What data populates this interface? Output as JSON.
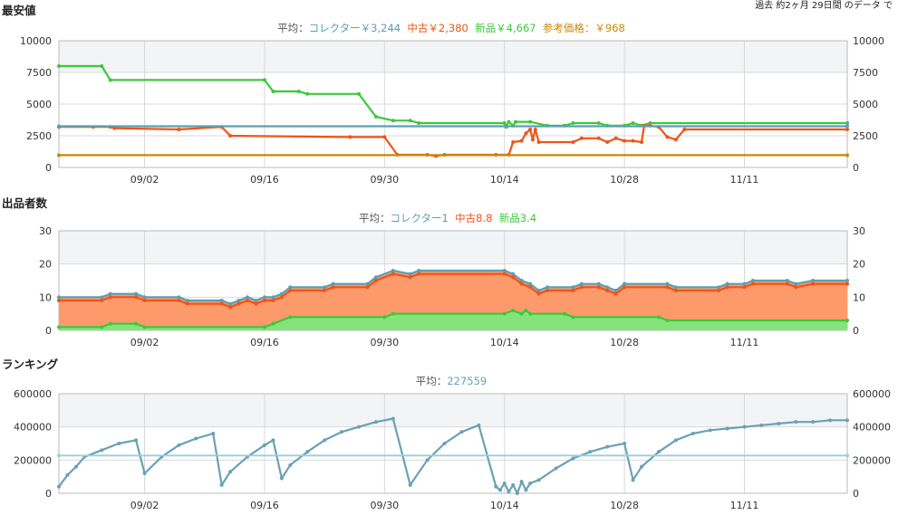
{
  "caption": "過去 約2ヶ月 29日間 のデータ で",
  "colors": {
    "collector": "#5b9fb4",
    "used": "#f25316",
    "new": "#3cc83c",
    "ref": "#c8880a",
    "used_fill": "#fd9a6c",
    "new_fill": "#86e37c",
    "rank": "#6aa1b6",
    "rank_avg": "#9ccfd8",
    "grid": "#d8d8d8",
    "band": "#f3f4f6"
  },
  "chart_data": [
    {
      "id": "price",
      "type": "line",
      "title": "最安値",
      "ylim": [
        0,
        10000
      ],
      "yticks": [
        "0",
        "2500",
        "5000",
        "7500",
        "10000"
      ],
      "xticks": [
        {
          "x": 10,
          "label": "09/02"
        },
        {
          "x": 24,
          "label": "09/16"
        },
        {
          "x": 38,
          "label": "09/30"
        },
        {
          "x": 52,
          "label": "10/14"
        },
        {
          "x": 66,
          "label": "10/28"
        },
        {
          "x": 80,
          "label": "11/11"
        }
      ],
      "xlim": [
        0,
        92
      ],
      "legend": [
        {
          "key": "collector",
          "label": "平均：コレクター￥3,244"
        },
        {
          "key": "used",
          "label": "中古￥2,380"
        },
        {
          "key": "new",
          "label": "新品￥4,667"
        },
        {
          "key": "ref",
          "label": "参考価格：￥968"
        }
      ],
      "series": [
        {
          "key": "new",
          "style": "line",
          "points": [
            [
              0,
              8000
            ],
            [
              5,
              8000
            ],
            [
              6,
              6900
            ],
            [
              24,
              6900
            ],
            [
              25,
              6000
            ],
            [
              28,
              6000
            ],
            [
              29,
              5800
            ],
            [
              35,
              5800
            ],
            [
              37,
              4000
            ],
            [
              39,
              3700
            ],
            [
              41,
              3700
            ],
            [
              42,
              3500
            ],
            [
              52,
              3500
            ],
            [
              52.2,
              3200
            ],
            [
              52.5,
              3600
            ],
            [
              53,
              3300
            ],
            [
              53.3,
              3600
            ],
            [
              55,
              3600
            ],
            [
              57,
              3300
            ],
            [
              59,
              3300
            ],
            [
              60,
              3500
            ],
            [
              63,
              3500
            ],
            [
              64,
              3300
            ],
            [
              66,
              3300
            ],
            [
              67,
              3500
            ],
            [
              68,
              3300
            ],
            [
              69,
              3500
            ],
            [
              92,
              3500
            ]
          ]
        },
        {
          "key": "used",
          "style": "line",
          "points": [
            [
              0,
              3200
            ],
            [
              4,
              3200
            ],
            [
              6,
              3200
            ],
            [
              6.5,
              3100
            ],
            [
              14,
              3000
            ],
            [
              19,
              3200
            ],
            [
              20,
              2500
            ],
            [
              34,
              2400
            ],
            [
              38,
              2400
            ],
            [
              39.5,
              1000
            ],
            [
              43,
              1000
            ],
            [
              44,
              900
            ],
            [
              45,
              1000
            ],
            [
              51,
              1000
            ],
            [
              52.5,
              1000
            ],
            [
              53,
              2000
            ],
            [
              54,
              2100
            ],
            [
              54.5,
              2700
            ],
            [
              55,
              3000
            ],
            [
              55.3,
              2200
            ],
            [
              55.6,
              3000
            ],
            [
              56,
              2000
            ],
            [
              60,
              2000
            ],
            [
              61,
              2300
            ],
            [
              63,
              2300
            ],
            [
              64,
              2000
            ],
            [
              65,
              2300
            ],
            [
              66,
              2100
            ],
            [
              67,
              2100
            ],
            [
              68,
              2000
            ],
            [
              68.3,
              3300
            ],
            [
              69,
              3300
            ],
            [
              70,
              3200
            ],
            [
              71,
              2400
            ],
            [
              72,
              2200
            ],
            [
              73,
              3000
            ],
            [
              92,
              3000
            ]
          ]
        },
        {
          "key": "collector",
          "style": "line",
          "points": [
            [
              0,
              3250
            ],
            [
              92,
              3250
            ],
            [
              92,
              3500
            ]
          ]
        },
        {
          "key": "ref",
          "style": "line",
          "points": [
            [
              0,
              968
            ],
            [
              92,
              968
            ]
          ]
        }
      ]
    },
    {
      "id": "sellers",
      "type": "area",
      "title": "出品者数",
      "ylim": [
        0,
        30
      ],
      "yticks": [
        "0",
        "10",
        "20",
        "30"
      ],
      "xticks": [
        {
          "x": 10,
          "label": "09/02"
        },
        {
          "x": 24,
          "label": "09/16"
        },
        {
          "x": 38,
          "label": "09/30"
        },
        {
          "x": 52,
          "label": "10/14"
        },
        {
          "x": 66,
          "label": "10/28"
        },
        {
          "x": 80,
          "label": "11/11"
        }
      ],
      "xlim": [
        0,
        92
      ],
      "legend": [
        {
          "key": "collector",
          "label": "平均：コレクター1"
        },
        {
          "key": "used",
          "label": "中古8.8"
        },
        {
          "key": "new",
          "label": "新品3.4"
        }
      ],
      "series": [
        {
          "key": "total",
          "style": "line",
          "points": [
            [
              0,
              10
            ],
            [
              5,
              10
            ],
            [
              6,
              11
            ],
            [
              9,
              11
            ],
            [
              10,
              10
            ],
            [
              14,
              10
            ],
            [
              15,
              9
            ],
            [
              19,
              9
            ],
            [
              20,
              8
            ],
            [
              21,
              9
            ],
            [
              22,
              10
            ],
            [
              23,
              9
            ],
            [
              24,
              10
            ],
            [
              25,
              10
            ],
            [
              26,
              11
            ],
            [
              27,
              13
            ],
            [
              31,
              13
            ],
            [
              32,
              14
            ],
            [
              36,
              14
            ],
            [
              37,
              16
            ],
            [
              39,
              18
            ],
            [
              41,
              17
            ],
            [
              42,
              18
            ],
            [
              52,
              18
            ],
            [
              53,
              17
            ],
            [
              54,
              15
            ],
            [
              55,
              14
            ],
            [
              56,
              12
            ],
            [
              57,
              13
            ],
            [
              60,
              13
            ],
            [
              61,
              14
            ],
            [
              63,
              14
            ],
            [
              64,
              13
            ],
            [
              65,
              12
            ],
            [
              66,
              14
            ],
            [
              71,
              14
            ],
            [
              72,
              13
            ],
            [
              77,
              13
            ],
            [
              78,
              14
            ],
            [
              80,
              14
            ],
            [
              81,
              15
            ],
            [
              85,
              15
            ],
            [
              86,
              14
            ],
            [
              88,
              15
            ],
            [
              92,
              15
            ]
          ]
        },
        {
          "key": "used",
          "style": "line",
          "points": [
            [
              0,
              9
            ],
            [
              5,
              9
            ],
            [
              6,
              10
            ],
            [
              9,
              10
            ],
            [
              10,
              9
            ],
            [
              14,
              9
            ],
            [
              15,
              8
            ],
            [
              19,
              8
            ],
            [
              20,
              7
            ],
            [
              21,
              8
            ],
            [
              22,
              9
            ],
            [
              23,
              8
            ],
            [
              24,
              9
            ],
            [
              25,
              9
            ],
            [
              26,
              10
            ],
            [
              27,
              12
            ],
            [
              31,
              12
            ],
            [
              32,
              13
            ],
            [
              36,
              13
            ],
            [
              37,
              15
            ],
            [
              39,
              17
            ],
            [
              41,
              16
            ],
            [
              42,
              17
            ],
            [
              52,
              17
            ],
            [
              53,
              16
            ],
            [
              54,
              14
            ],
            [
              55,
              13
            ],
            [
              56,
              11
            ],
            [
              57,
              12
            ],
            [
              60,
              12
            ],
            [
              61,
              13
            ],
            [
              63,
              13
            ],
            [
              64,
              12
            ],
            [
              65,
              11
            ],
            [
              66,
              13
            ],
            [
              71,
              13
            ],
            [
              72,
              12
            ],
            [
              77,
              12
            ],
            [
              78,
              13
            ],
            [
              80,
              13
            ],
            [
              81,
              14
            ],
            [
              85,
              14
            ],
            [
              86,
              13
            ],
            [
              88,
              14
            ],
            [
              92,
              14
            ]
          ]
        },
        {
          "key": "new",
          "style": "line",
          "points": [
            [
              0,
              1
            ],
            [
              5,
              1
            ],
            [
              6,
              2
            ],
            [
              9,
              2
            ],
            [
              10,
              1
            ],
            [
              24,
              1
            ],
            [
              25,
              2
            ],
            [
              27,
              4
            ],
            [
              38,
              4
            ],
            [
              39,
              5
            ],
            [
              52,
              5
            ],
            [
              53,
              6
            ],
            [
              54,
              5
            ],
            [
              54.5,
              6
            ],
            [
              55,
              5
            ],
            [
              59,
              5
            ],
            [
              60,
              4
            ],
            [
              70,
              4
            ],
            [
              71,
              3
            ],
            [
              92,
              3
            ]
          ]
        }
      ]
    },
    {
      "id": "ranking",
      "type": "line",
      "title": "ランキング",
      "ylim": [
        0,
        600000
      ],
      "yticks": [
        "0",
        "200000",
        "400000",
        "600000"
      ],
      "xticks": [
        {
          "x": 10,
          "label": "09/02"
        },
        {
          "x": 24,
          "label": "09/16"
        },
        {
          "x": 38,
          "label": "09/30"
        },
        {
          "x": 52,
          "label": "10/14"
        },
        {
          "x": 66,
          "label": "10/28"
        },
        {
          "x": 80,
          "label": "11/11"
        }
      ],
      "xlim": [
        0,
        92
      ],
      "legend": [
        {
          "key": "rank",
          "label": "平均：227559"
        }
      ],
      "average": 227559,
      "series": [
        {
          "key": "rank",
          "style": "line",
          "points": [
            [
              0,
              40000
            ],
            [
              1,
              110000
            ],
            [
              2,
              160000
            ],
            [
              3,
              220000
            ],
            [
              5,
              260000
            ],
            [
              7,
              300000
            ],
            [
              9,
              320000
            ],
            [
              10,
              120000
            ],
            [
              12,
              220000
            ],
            [
              14,
              290000
            ],
            [
              16,
              330000
            ],
            [
              18,
              360000
            ],
            [
              19,
              50000
            ],
            [
              20,
              130000
            ],
            [
              22,
              220000
            ],
            [
              24,
              290000
            ],
            [
              25,
              320000
            ],
            [
              26,
              90000
            ],
            [
              27,
              170000
            ],
            [
              29,
              250000
            ],
            [
              31,
              320000
            ],
            [
              33,
              370000
            ],
            [
              35,
              400000
            ],
            [
              37,
              430000
            ],
            [
              39,
              450000
            ],
            [
              41,
              50000
            ],
            [
              43,
              200000
            ],
            [
              45,
              300000
            ],
            [
              47,
              370000
            ],
            [
              49,
              410000
            ],
            [
              51,
              40000
            ],
            [
              51.5,
              20000
            ],
            [
              52,
              60000
            ],
            [
              52.5,
              10000
            ],
            [
              53,
              50000
            ],
            [
              53.5,
              0
            ],
            [
              54,
              70000
            ],
            [
              54.5,
              20000
            ],
            [
              55,
              60000
            ],
            [
              56,
              80000
            ],
            [
              58,
              150000
            ],
            [
              60,
              210000
            ],
            [
              62,
              250000
            ],
            [
              64,
              280000
            ],
            [
              66,
              300000
            ],
            [
              67,
              80000
            ],
            [
              68,
              160000
            ],
            [
              70,
              250000
            ],
            [
              72,
              320000
            ],
            [
              74,
              360000
            ],
            [
              76,
              380000
            ],
            [
              78,
              390000
            ],
            [
              80,
              400000
            ],
            [
              82,
              410000
            ],
            [
              84,
              420000
            ],
            [
              86,
              430000
            ],
            [
              88,
              430000
            ],
            [
              90,
              440000
            ],
            [
              92,
              440000
            ]
          ]
        },
        {
          "key": "rank_avg",
          "style": "flat",
          "points": [
            [
              0,
              227559
            ],
            [
              92,
              227559
            ]
          ]
        }
      ]
    }
  ]
}
